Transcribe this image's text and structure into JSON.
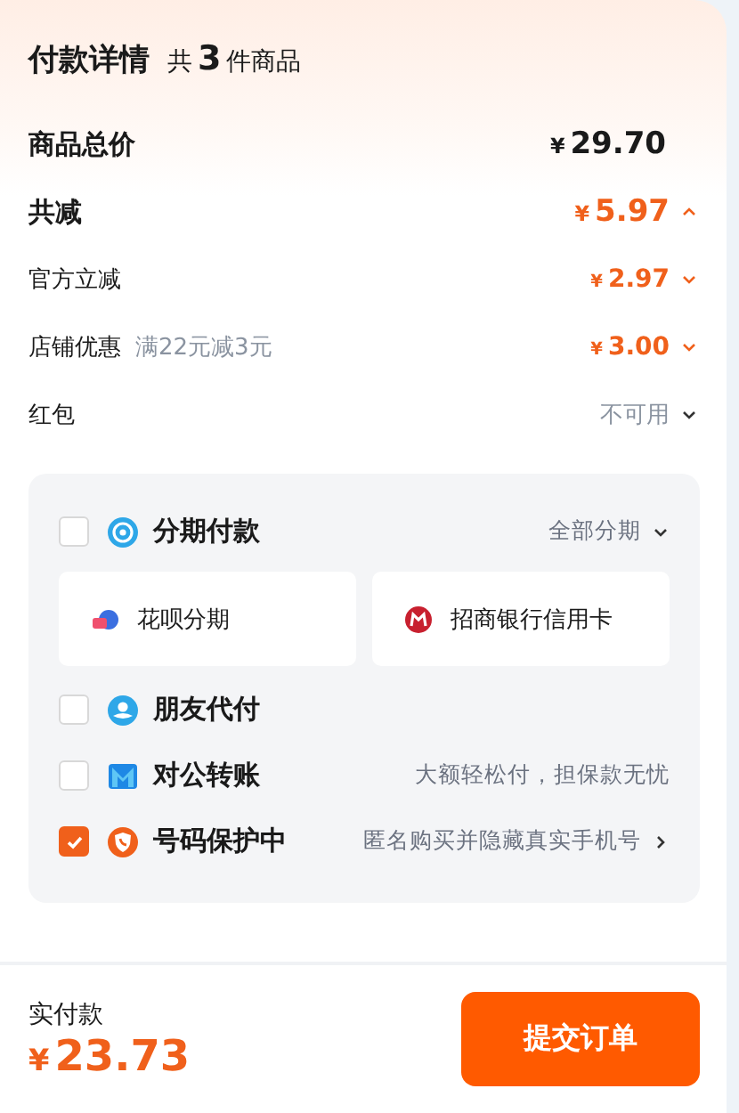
{
  "header": {
    "title": "付款详情",
    "count_prefix": "共",
    "count": "3",
    "count_suffix": "件商品"
  },
  "price_rows": [
    {
      "kind": "total",
      "label": "商品总价",
      "currency": "¥",
      "amount": "29.70"
    },
    {
      "kind": "discount",
      "label": "共减",
      "currency": "¥",
      "amount": "5.97",
      "expanded": true
    },
    {
      "kind": "sub",
      "label": "官方立减",
      "currency": "¥",
      "amount": "2.97",
      "expanded": false
    },
    {
      "kind": "sub",
      "label": "店铺优惠",
      "note": "满22元减3元",
      "currency": "¥",
      "amount": "3.00",
      "expanded": false
    },
    {
      "kind": "status",
      "label": "红包",
      "status": "不可用",
      "expanded": false
    }
  ],
  "payment_options": [
    {
      "kind": "installment",
      "label": "分期付款",
      "checked": false,
      "action": "全部分期",
      "sub_options": [
        {
          "kind": "huabei",
          "label": "花呗分期"
        },
        {
          "kind": "bank",
          "label": "招商银行信用卡"
        }
      ]
    },
    {
      "kind": "friend",
      "label": "朋友代付",
      "checked": false
    },
    {
      "kind": "transfer",
      "label": "对公转账",
      "checked": false,
      "hint": "大额轻松付，担保款无忧"
    },
    {
      "kind": "privacy",
      "label": "号码保护中",
      "checked": true,
      "hint": "匿名购买并隐藏真实手机号",
      "link": true
    }
  ],
  "footer": {
    "label": "实付款",
    "currency": "¥",
    "amount": "23.73",
    "button": "提交订单"
  }
}
